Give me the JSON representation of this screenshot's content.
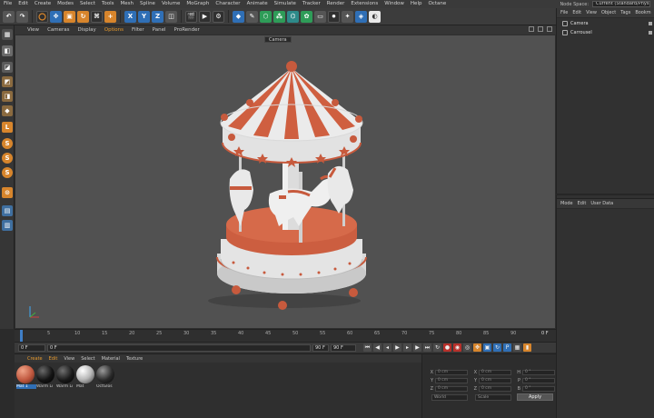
{
  "menubar": {
    "items": [
      "File",
      "Edit",
      "Create",
      "Modes",
      "Select",
      "Tools",
      "Mesh",
      "Spline",
      "Volume",
      "MoGraph",
      "Character",
      "Animate",
      "Simulate",
      "Tracker",
      "Render",
      "Extensions",
      "Window",
      "Help",
      "Octane"
    ],
    "node_space_label": "Node Space:",
    "node_space_value": "Current (Standard/Physical)"
  },
  "toolbar": {
    "axis_x": "X",
    "axis_y": "Y",
    "axis_z": "Z"
  },
  "left_tools": {
    "s1": "S",
    "s2": "S",
    "s3": "S"
  },
  "viewport": {
    "menu": [
      "View",
      "Cameras",
      "Display",
      "Options",
      "Filter",
      "Panel",
      "ProRender"
    ],
    "highlighted_menu": "Options",
    "camera_label": "Camera"
  },
  "timeline": {
    "ticks": [
      "0",
      "5",
      "10",
      "15",
      "20",
      "25",
      "30",
      "35",
      "40",
      "45",
      "50",
      "55",
      "60",
      "65",
      "70",
      "75",
      "80",
      "85",
      "90"
    ],
    "end_label": "0 F"
  },
  "controls": {
    "current_frame": "0 F",
    "start_frame": "0 F",
    "end_frame": "90 F",
    "end_frame2": "90 F"
  },
  "materials": {
    "menu": [
      "Create",
      "Edit",
      "View",
      "Select",
      "Material",
      "Texture"
    ],
    "items": [
      {
        "label": "Mat 1",
        "color": "#c0583f"
      },
      {
        "label": "Warm Li",
        "color": "#141414"
      },
      {
        "label": "Warm Li",
        "color": "#1a1a1a"
      },
      {
        "label": "Mat",
        "color": "#b9b9b9"
      },
      {
        "label": "OctGlos",
        "color": "#2a2a2a"
      }
    ]
  },
  "coordinates": {
    "rows": [
      {
        "a": "X",
        "av": "0 cm",
        "b": "X",
        "bv": "0 cm",
        "c": "H",
        "cv": "0 °"
      },
      {
        "a": "Y",
        "av": "0 cm",
        "b": "Y",
        "bv": "0 cm",
        "c": "P",
        "cv": "0 °"
      },
      {
        "a": "Z",
        "av": "0 cm",
        "b": "Z",
        "bv": "0 cm",
        "c": "B",
        "cv": "0 °"
      }
    ],
    "mode_select": "World",
    "scale_select": "Scale",
    "apply_label": "Apply"
  },
  "object_manager": {
    "menu": [
      "File",
      "Edit",
      "View",
      "Object",
      "Tags",
      "Bookm"
    ],
    "objects": [
      {
        "name": "Camera"
      },
      {
        "name": "Carrousel"
      }
    ]
  },
  "attribute_manager": {
    "menu": [
      "Mode",
      "Edit",
      "User Data"
    ]
  },
  "colors": {
    "accent": "#e79a2e",
    "carousel_orange": "#d2613f",
    "carousel_white": "#e4e4e4",
    "viewport_bg": "#515151"
  }
}
